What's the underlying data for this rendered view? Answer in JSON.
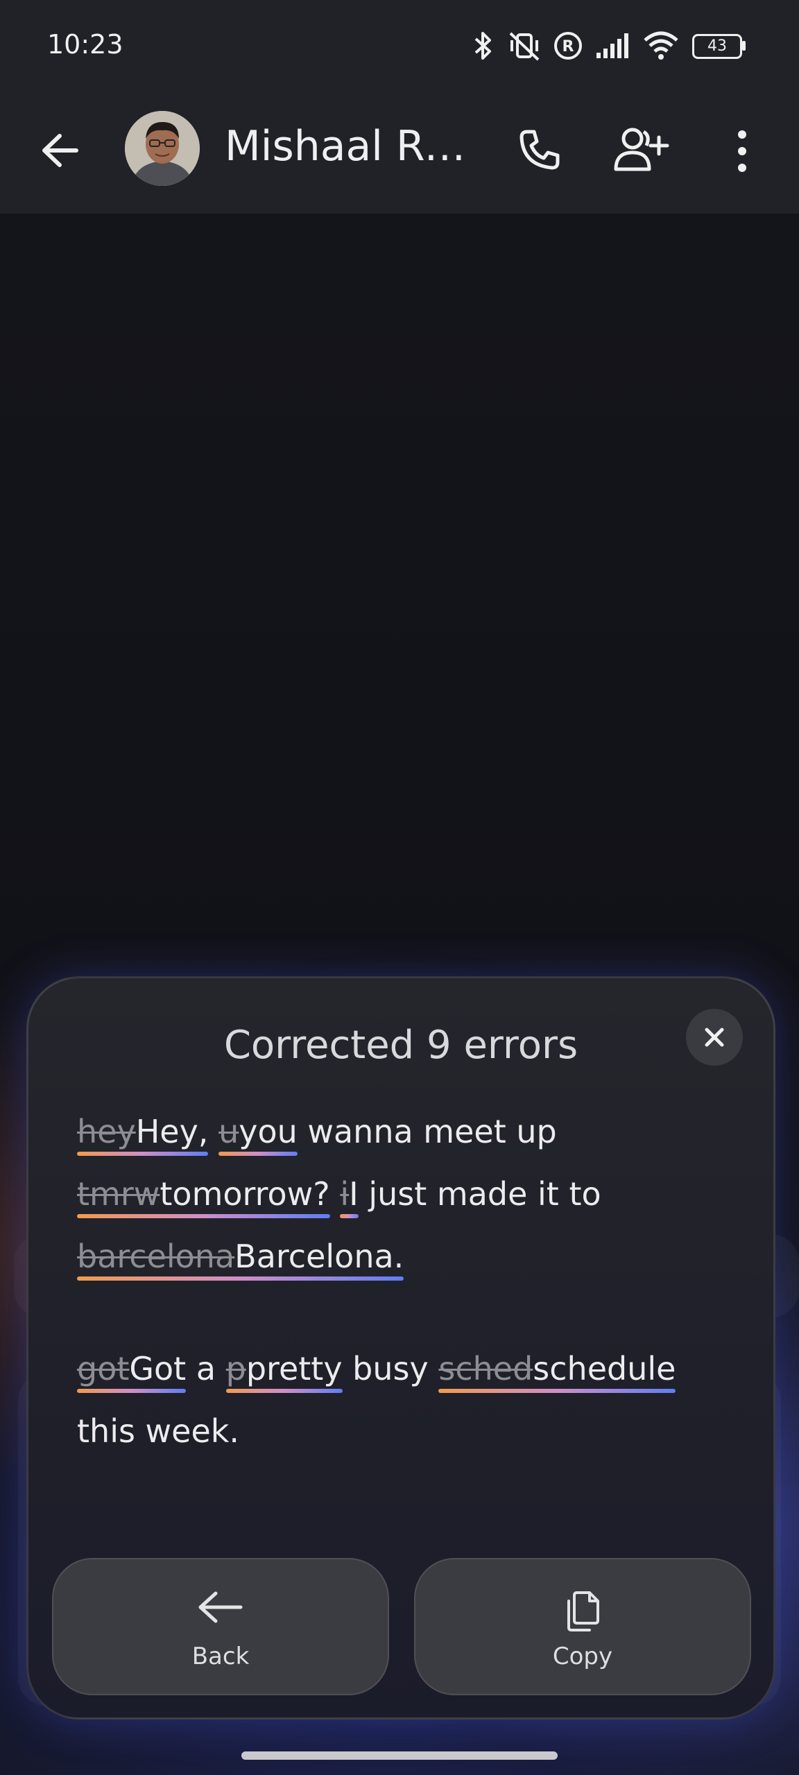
{
  "status_bar": {
    "time": "10:23",
    "battery": "43",
    "icons": [
      "bluetooth-icon",
      "vibrate-off-icon",
      "registered-icon",
      "signal-icon",
      "wifi-icon",
      "battery-icon"
    ]
  },
  "header": {
    "contact_name": "Mishaal Ra...",
    "icons": [
      "back-arrow-icon",
      "phone-icon",
      "add-person-icon",
      "more-vert-icon"
    ]
  },
  "panel": {
    "title": "Corrected 9 errors",
    "paragraph1": [
      {
        "del": "hey",
        "fix": "Hey,"
      },
      {
        "del": "u",
        "fix": "you",
        "tail": " wanna meet up"
      },
      {
        "del": "tmrw",
        "fix": "tomorrow?"
      },
      {
        "del": "i",
        "fix": "I",
        "tail": " just made it to"
      },
      {
        "del": "barcelona",
        "fix": "Barcelona."
      }
    ],
    "paragraph2": [
      {
        "del": "got",
        "fix": "Got",
        "tail": " a "
      },
      {
        "del": "p",
        "fix": "pretty",
        "tail": " busy "
      },
      {
        "del": "sched",
        "fix": "schedule"
      },
      {
        "text": "this week."
      }
    ],
    "back_label": "Back",
    "copy_label": "Copy"
  },
  "colors": {
    "panel_background": "#202129",
    "underline_start": "#f29a4f",
    "underline_end": "#5e7ef5",
    "button_background": "#3b3c41"
  }
}
